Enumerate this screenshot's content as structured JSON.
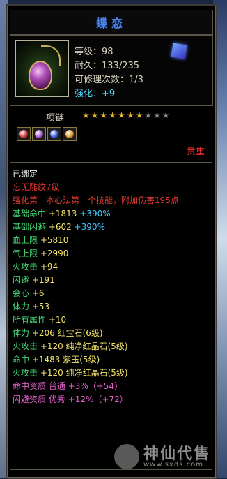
{
  "item": {
    "name": "蝶恋",
    "level": "等级：98",
    "durability": "耐久：133/235",
    "repair": "可修理次数：1/3",
    "enhance": "强化：+9",
    "type": "项链",
    "stars_total": 10,
    "stars_on": 7,
    "rarity": "贵重",
    "bound": "已绑定",
    "set_name": "忘无雕纹7级",
    "skill_desc": "强化第一本心法第一个技能，附加伤害195点"
  },
  "sockets": [
    {
      "icon": "red-gem-icon",
      "color": "#d13a3a"
    },
    {
      "icon": "purple-gem-icon",
      "color": "#a65bd6"
    },
    {
      "icon": "blue-gem-icon",
      "color": "#3f5be0"
    },
    {
      "icon": "orange-gem-icon",
      "color": "#e09a2e"
    }
  ],
  "attrs": [
    {
      "label": "基础命中",
      "value": "+1813",
      "extra": "+390%"
    },
    {
      "label": "基础闪避",
      "value": "+602",
      "extra": "+390%"
    },
    {
      "label": "血上限",
      "value": "+5810"
    },
    {
      "label": "气上限",
      "value": "+2990"
    },
    {
      "label": "火攻击",
      "value": "+94"
    },
    {
      "label": "闪避",
      "value": "+191"
    },
    {
      "label": "会心",
      "value": "+6"
    },
    {
      "label": "体力",
      "value": "+53"
    },
    {
      "label": "所有属性",
      "value": "+10"
    }
  ],
  "gems": [
    {
      "label": "体力",
      "value": "+206",
      "gem": "红宝石(6级)"
    },
    {
      "label": "火攻击",
      "value": "+120",
      "gem": "纯净红晶石(5级)"
    },
    {
      "label": "命中",
      "value": "+1483",
      "gem": "紫玉(5级)"
    },
    {
      "label": "火攻击",
      "value": "+120",
      "gem": "纯净红晶石(5级)"
    }
  ],
  "quals": [
    {
      "label": "命中资质",
      "grade": "普通",
      "value": "+3%（+54）"
    },
    {
      "label": "闪避资质",
      "grade": "优秀",
      "value": "+12%（+72）"
    }
  ],
  "watermark": {
    "name": "神仙代售",
    "url": "www.sxds.com"
  }
}
